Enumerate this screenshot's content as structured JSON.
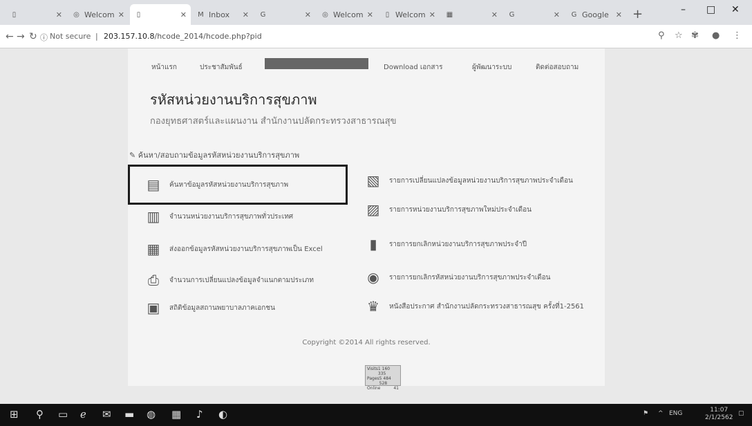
{
  "browser": {
    "tabs": [
      {
        "title": "",
        "icon": "page-icon",
        "active": false
      },
      {
        "title": "Welcom",
        "icon": "globe-icon",
        "active": false
      },
      {
        "title": "",
        "icon": "page-icon",
        "active": true
      },
      {
        "title": "Inbox",
        "icon": "gmail-icon",
        "active": false
      },
      {
        "title": "",
        "icon": "google-icon",
        "active": false
      },
      {
        "title": "Welcom",
        "icon": "globe-icon",
        "active": false
      },
      {
        "title": "Welcom",
        "icon": "page-icon",
        "active": false
      },
      {
        "title": "",
        "icon": "sheet-icon",
        "active": false
      },
      {
        "title": "",
        "icon": "google-icon",
        "active": false
      },
      {
        "title": "Google",
        "icon": "google-icon",
        "active": false
      }
    ],
    "new_tab": "+",
    "minimize": "–",
    "maximize": "□",
    "close": "✕",
    "not_secure": "Not secure",
    "url_host": "203.157.10.8",
    "url_path": "/hcode_2014/hcode.php?pid"
  },
  "site": {
    "nav": [
      "หน้าแรก",
      "ประชาสัมพันธ์",
      "",
      "Download เอกสาร",
      "ผู้พัฒนาระบบ",
      "ติดต่อสอบถาม"
    ],
    "title": "รหัสหน่วยงานบริการสุขภาพ",
    "subtitle": "กองยุทธศาสตร์และแผนงาน สำนักงานปลัดกระทรวงสาธารณสุข",
    "section": "ค้นหา/สอบถามข้อมูลรหัสหน่วยงานบริการสุขภาพ",
    "items_left": [
      {
        "label": "ค้นหาข้อมูลรหัสหน่วยงานบริการสุขภาพ",
        "icon": "search-doc-icon"
      },
      {
        "label": "จำนวนหน่วยงานบริการสุขภาพทั่วประเทศ",
        "icon": "chart-icon"
      },
      {
        "label": "ส่งออกข้อมูลรหัสหน่วยงานบริการสุขภาพเป็น Excel",
        "icon": "excel-export-icon"
      },
      {
        "label": "จำนวนการเปลี่ยนแปลงข้อมูลจำแนกตามประเภท",
        "icon": "printer-icon"
      },
      {
        "label": "สถิติข้อมูลสถานพยาบาลภาคเอกชน",
        "icon": "clipboard-icon"
      }
    ],
    "items_right": [
      {
        "label": "รายการเปลี่ยนแปลงข้อมูลหน่วยงานบริการสุขภาพประจำเดือน",
        "icon": "presentation-icon"
      },
      {
        "label": "รายการหน่วยงานบริการสุขภาพใหม่ประจำเดือน",
        "icon": "calendar-icon"
      },
      {
        "label": "รายการยกเลิกหน่วยงานบริการสุขภาพประจำปี",
        "icon": "bar-chart-icon"
      },
      {
        "label": "รายการยกเลิกรหัสหน่วยงานบริการสุขภาพประจำเดือน",
        "icon": "disc-icon"
      },
      {
        "label": "หนังสือประกาศ สำนักงานปลัดกระทรวงสาธารณสุข ครั้งที่1-2561",
        "icon": "garuda-emblem-icon"
      }
    ],
    "copyright": "Copyright ©2014  All rights reserved.",
    "stats": {
      "title": "",
      "rows": [
        [
          "Visits",
          "1 160 335"
        ],
        [
          "Pages",
          "5 484 528"
        ],
        [
          "Online",
          "41"
        ]
      ]
    }
  },
  "taskbar": {
    "lang": "ENG",
    "time": "11:07",
    "date": "2/1/2562"
  }
}
